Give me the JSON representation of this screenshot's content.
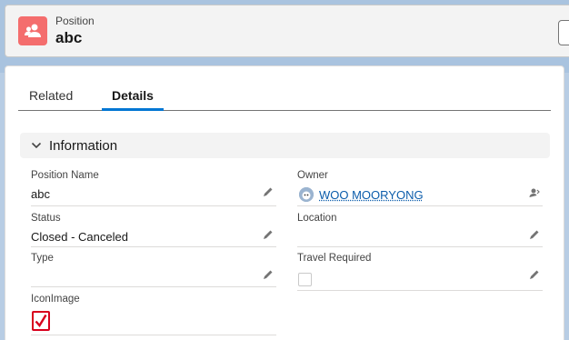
{
  "header": {
    "object_label": "Position",
    "record_name": "abc"
  },
  "tabs": [
    {
      "label": "Related",
      "active": false
    },
    {
      "label": "Details",
      "active": true
    }
  ],
  "section": {
    "title": "Information"
  },
  "fields": {
    "position_name": {
      "label": "Position Name",
      "value": "abc"
    },
    "owner": {
      "label": "Owner",
      "value": "WOO MOORYONG"
    },
    "status": {
      "label": "Status",
      "value": "Closed - Canceled"
    },
    "location": {
      "label": "Location",
      "value": ""
    },
    "type": {
      "label": "Type",
      "value": ""
    },
    "travel_required": {
      "label": "Travel Required",
      "checked": false
    },
    "icon_image": {
      "label": "IconImage",
      "checked": true
    }
  },
  "colors": {
    "brand_icon": "#f46d6d",
    "link": "#0b5cab",
    "active_tab": "#0176d3",
    "checkbox_highlight": "#d8001d"
  }
}
